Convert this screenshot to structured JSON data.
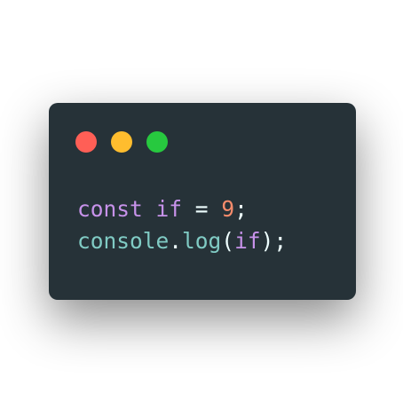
{
  "window": {
    "background": "#263238",
    "traffic_lights": [
      {
        "name": "close",
        "color": "#ff5f56"
      },
      {
        "name": "minimize",
        "color": "#ffbd2e"
      },
      {
        "name": "zoom",
        "color": "#27c93f"
      }
    ]
  },
  "colors": {
    "keyword": "#c792ea",
    "number": "#f78c6c",
    "function": "#80cbc4",
    "plain": "#eeffff"
  },
  "code": {
    "line1": [
      {
        "text": "const",
        "color": "#c792ea"
      },
      {
        "text": " ",
        "color": "#eeffff"
      },
      {
        "text": "if",
        "color": "#c792ea"
      },
      {
        "text": " = ",
        "color": "#eeffff"
      },
      {
        "text": "9",
        "color": "#f78c6c"
      },
      {
        "text": ";",
        "color": "#eeffff"
      }
    ],
    "line2": [
      {
        "text": "console",
        "color": "#80cbc4"
      },
      {
        "text": ".",
        "color": "#eeffff"
      },
      {
        "text": "log",
        "color": "#80cbc4"
      },
      {
        "text": "(",
        "color": "#eeffff"
      },
      {
        "text": "if",
        "color": "#c792ea"
      },
      {
        "text": ");",
        "color": "#eeffff"
      }
    ]
  }
}
